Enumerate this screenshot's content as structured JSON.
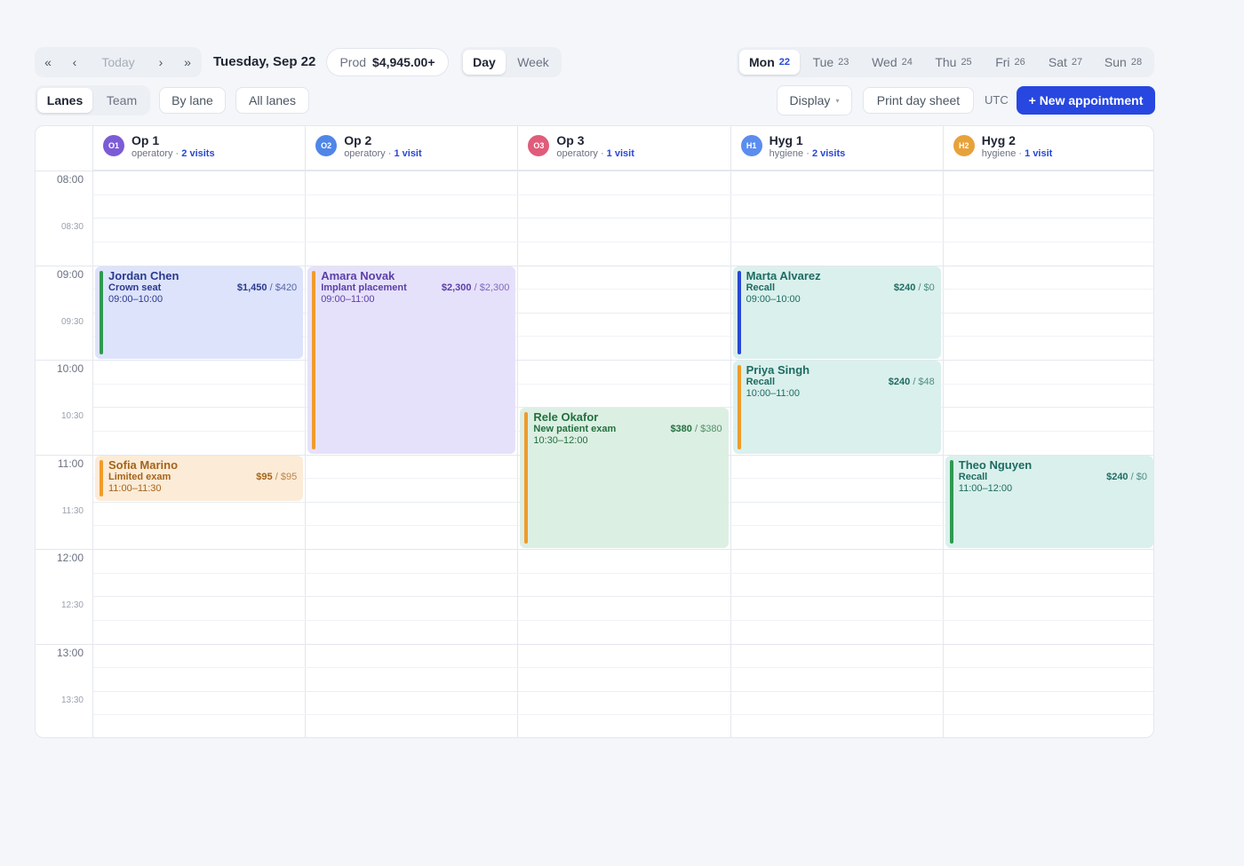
{
  "toolbar": {
    "nav_first": "«",
    "nav_prev": "‹",
    "today_label": "Today",
    "nav_next": "›",
    "nav_last": "»",
    "current_date": "Tuesday, Sep 22",
    "prod_label": "Prod",
    "prod_value": "$4,945.00+",
    "view_day": "Day",
    "view_week": "Week"
  },
  "week_days": [
    {
      "name": "Mon",
      "num": "22",
      "selected": true
    },
    {
      "name": "Tue",
      "num": "23"
    },
    {
      "name": "Wed",
      "num": "24"
    },
    {
      "name": "Thu",
      "num": "25"
    },
    {
      "name": "Fri",
      "num": "26"
    },
    {
      "name": "Sat",
      "num": "27"
    },
    {
      "name": "Sun",
      "num": "28"
    }
  ],
  "subbar": {
    "mode_lanes": "Lanes",
    "mode_team": "Team",
    "by_lane": "By lane",
    "all_lanes": "All lanes",
    "display": "Display",
    "display_caret": "▾",
    "print": "Print day sheet",
    "timezone": "UTC",
    "new_appointment": "+ New appointment"
  },
  "times": {
    "hours": [
      "08:00",
      "09:00",
      "10:00",
      "11:00",
      "12:00",
      "13:00"
    ],
    "halves": [
      "08:30",
      "09:30",
      "10:30",
      "11:30",
      "12:30",
      "13:30"
    ]
  },
  "lanes": [
    {
      "code": "O1",
      "name": "Op 1",
      "type": "operatory",
      "sep": "·",
      "visits": "2 visits",
      "color": "#7c5cd6"
    },
    {
      "code": "O2",
      "name": "Op 2",
      "type": "operatory",
      "sep": "·",
      "visits": "1 visit",
      "color": "#4f86e8"
    },
    {
      "code": "O3",
      "name": "Op 3",
      "type": "operatory",
      "sep": "·",
      "visits": "1 visit",
      "color": "#e05c7a"
    },
    {
      "code": "H1",
      "name": "Hyg 1",
      "type": "hygiene",
      "sep": "·",
      "visits": "2 visits",
      "color": "#5b8def"
    },
    {
      "code": "H2",
      "name": "Hyg 2",
      "type": "hygiene",
      "sep": "·",
      "visits": "1 visit",
      "color": "#e8a23a"
    }
  ],
  "appointments": [
    {
      "lane": 0,
      "start": "09:00",
      "end": "10:00",
      "patient": "Jordan Chen",
      "procedure": "Crown seat",
      "time": "09:00–10:00",
      "fee": "$1,450",
      "paid": "/ $420",
      "bg": "#dde3fb",
      "bar": "#2e9a4f",
      "text": "#2a3a8c"
    },
    {
      "lane": 0,
      "start": "11:00",
      "end": "11:30",
      "patient": "Sofia Marino",
      "procedure": "Limited exam",
      "time": "11:00–11:30",
      "fee": "$95",
      "paid": "/ $95",
      "bg": "#fcebd7",
      "bar": "#ef9b2c",
      "text": "#a4641a"
    },
    {
      "lane": 1,
      "start": "09:00",
      "end": "11:00",
      "patient": "Amara Novak",
      "procedure": "Implant placement",
      "time": "09:00–11:00",
      "fee": "$2,300",
      "paid": "/ $2,300",
      "bg": "#e6e1fa",
      "bar": "#ef9b2c",
      "text": "#5a3fa8"
    },
    {
      "lane": 2,
      "start": "10:30",
      "end": "12:00",
      "patient": "Rele Okafor",
      "procedure": "New patient exam",
      "time": "10:30–12:00",
      "fee": "$380",
      "paid": "/ $380",
      "bg": "#dcefe3",
      "bar": "#ef9b2c",
      "text": "#23703f"
    },
    {
      "lane": 3,
      "start": "09:00",
      "end": "10:00",
      "patient": "Marta Alvarez",
      "procedure": "Recall",
      "time": "09:00–10:00",
      "fee": "$240",
      "paid": "/ $0",
      "bg": "#daf0ec",
      "bar": "#2747d6",
      "text": "#1e6b62"
    },
    {
      "lane": 3,
      "start": "10:00",
      "end": "11:00",
      "patient": "Priya Singh",
      "procedure": "Recall",
      "time": "10:00–11:00",
      "fee": "$240",
      "paid": "/ $48",
      "bg": "#daf0ec",
      "bar": "#ef9b2c",
      "text": "#1e6b62"
    },
    {
      "lane": 4,
      "start": "11:00",
      "end": "12:00",
      "patient": "Theo Nguyen",
      "procedure": "Recall",
      "time": "11:00–12:00",
      "fee": "$240",
      "paid": "/ $0",
      "bg": "#daf0ec",
      "bar": "#2e9a4f",
      "text": "#1e6b62"
    }
  ]
}
